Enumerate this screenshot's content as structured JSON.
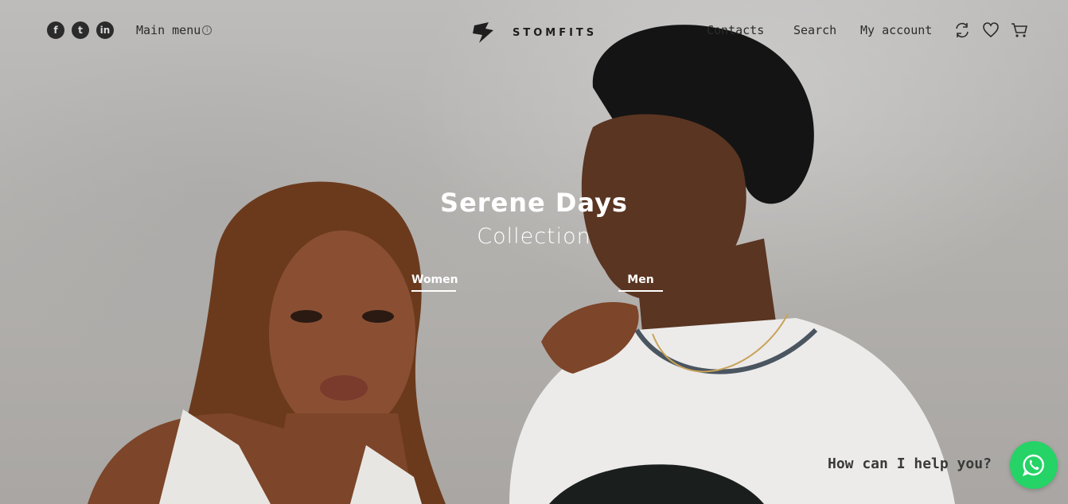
{
  "header": {
    "socials": [
      {
        "name": "facebook-icon",
        "glyph": "f"
      },
      {
        "name": "twitter-icon",
        "glyph": "t"
      },
      {
        "name": "linkedin-icon",
        "glyph": "in"
      }
    ],
    "main_menu_label": "Main menu",
    "main_menu_info_glyph": "i",
    "logo_text": "STOMFITS",
    "nav": {
      "contacts": "Contacts",
      "search": "Search",
      "account": "My account"
    }
  },
  "hero": {
    "title": "Serene Days",
    "subtitle": "Collection",
    "links": {
      "women": "Women",
      "men": "Men"
    }
  },
  "chat": {
    "prompt": "How can I help you?"
  },
  "colors": {
    "accent_whatsapp": "#25d366",
    "text_dark": "#2b2b2b",
    "hero_text": "#ffffff"
  }
}
